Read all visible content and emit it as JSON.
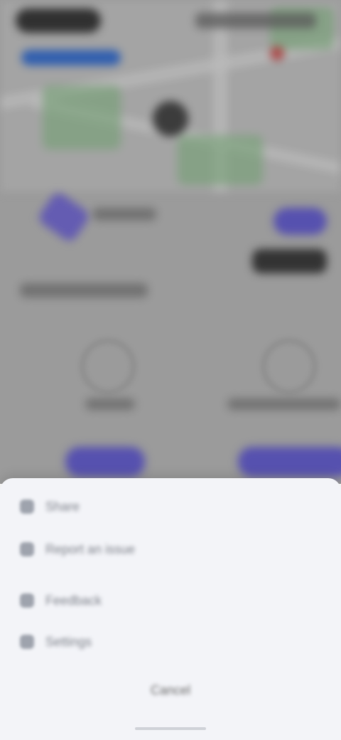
{
  "menu": {
    "items": [
      {
        "icon": "share-icon",
        "label": "Share"
      },
      {
        "icon": "report-icon",
        "label": "Report an issue"
      },
      {
        "icon": "feedback-icon",
        "label": "Feedback"
      },
      {
        "icon": "help-icon",
        "label": "Settings"
      }
    ],
    "cancel_label": "Cancel"
  },
  "colors": {
    "accent": "#6a63d6",
    "sheet_bg": "#f3f4f8",
    "backdrop": "#bdbdbd"
  }
}
